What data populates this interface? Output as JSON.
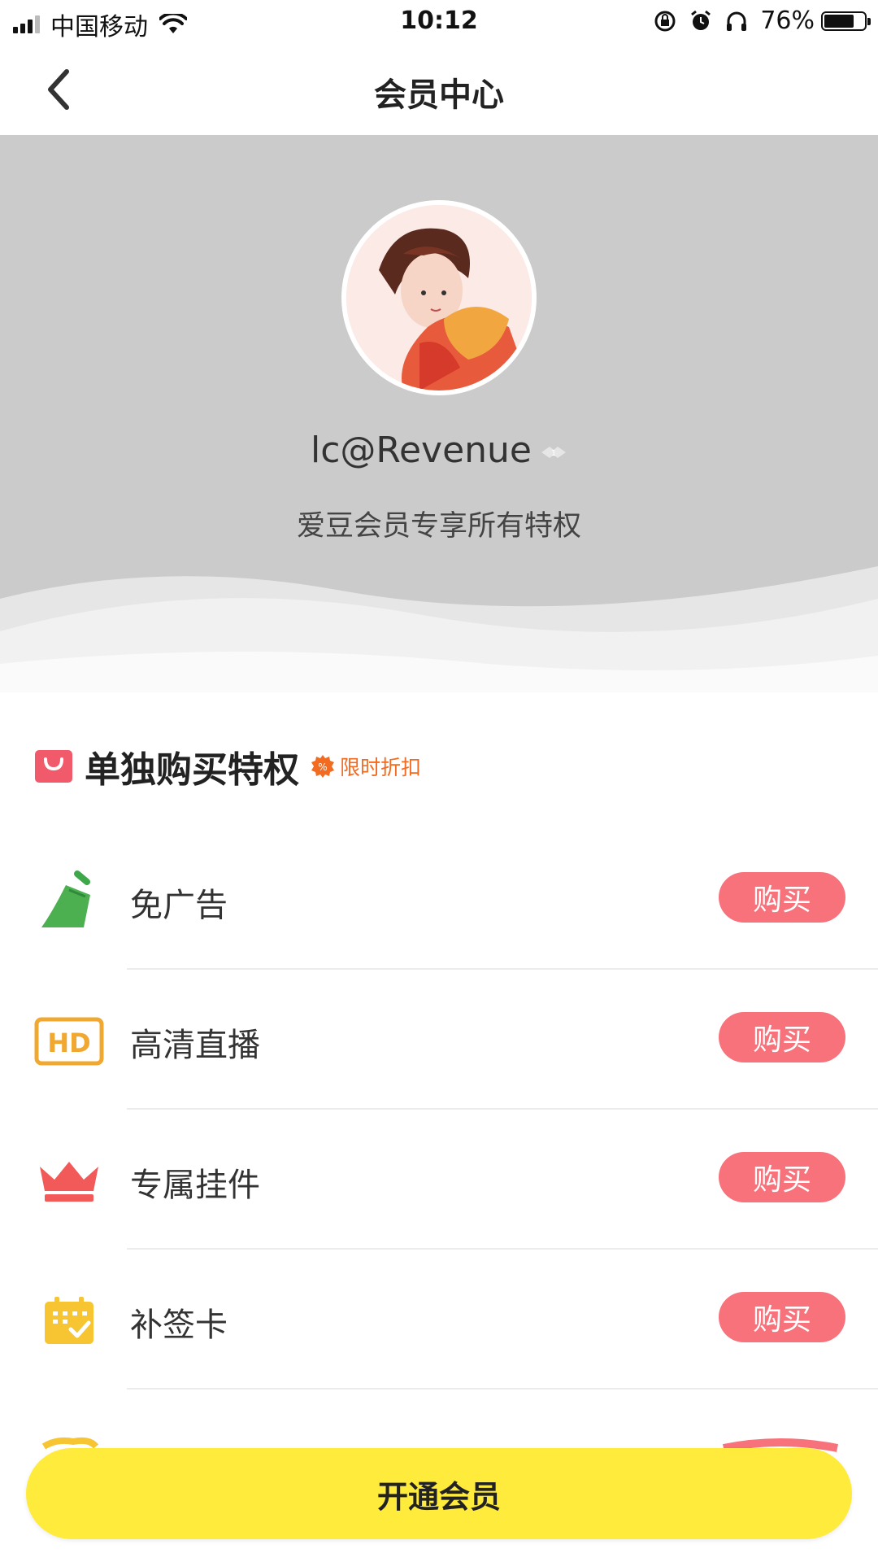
{
  "status_bar": {
    "carrier": "中国移动",
    "time": "10:12",
    "battery": "76%",
    "battery_level": 0.76
  },
  "nav": {
    "title": "会员中心"
  },
  "profile": {
    "username": "lc@Revenue",
    "subtitle": "爱豆会员专享所有特权"
  },
  "section": {
    "title": "单独购买特权",
    "tag": "限时折扣"
  },
  "privileges": [
    {
      "label": "免广告",
      "button": "购买",
      "icon": "broom-icon",
      "color": "#4caf50"
    },
    {
      "label": "高清直播",
      "button": "购买",
      "icon": "hd-icon",
      "color": "#f0a830"
    },
    {
      "label": "专属挂件",
      "button": "购买",
      "icon": "crown-icon",
      "color": "#f25a5a"
    },
    {
      "label": "补签卡",
      "button": "购买",
      "icon": "calendar-check-icon",
      "color": "#f7c531"
    }
  ],
  "cta": {
    "label": "开通会员"
  },
  "colors": {
    "header_bg": "#cbcbcb",
    "buy_button": "#f7727b",
    "cta": "#ffeb3b",
    "discount": "#f26b21"
  }
}
